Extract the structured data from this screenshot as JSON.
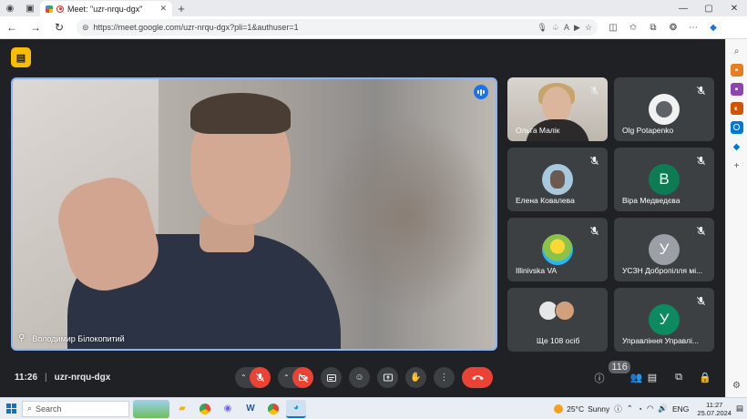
{
  "browser": {
    "tab_title": "Meet: \"uzr-nrqu-dgx\"",
    "url": "https://meet.google.com/uzr-nrqu-dgx?pli=1&authuser=1"
  },
  "meet": {
    "main_speaker": {
      "name": "Володимир Білокопитий"
    },
    "participants": [
      {
        "name": "Ольга Малік",
        "type": "photo"
      },
      {
        "name": "Olg Potapenko",
        "type": "image",
        "avatar_color": "#5f6368"
      },
      {
        "name": "Елена Ковалева",
        "type": "image",
        "avatar_color": "#7aa7c7"
      },
      {
        "name": "Віра Медведєва",
        "type": "initial",
        "initial": "В",
        "avatar_color": "#0d7c54"
      },
      {
        "name": "Illinivska VA",
        "type": "image",
        "avatar_color": "#8bc34a"
      },
      {
        "name": "УСЗН Добропілля мі...",
        "type": "initial",
        "initial": "У",
        "avatar_color": "#9aa0a6"
      },
      {
        "name": "Ще 108 осіб",
        "type": "group"
      },
      {
        "name": "Управління Управлі...",
        "type": "initial",
        "initial": "У",
        "avatar_color": "#0d8a5f"
      }
    ],
    "time": "11:26",
    "meeting_code": "uzr-nrqu-dgx",
    "people_count": "116"
  },
  "taskbar": {
    "search_placeholder": "Search",
    "temperature": "25°C",
    "weather": "Sunny",
    "language": "ENG",
    "clock_time": "11:27",
    "clock_date": "25.07.2024"
  },
  "colors": {
    "meet_bg": "#202124",
    "tile_bg": "#3c4043",
    "active_border": "#8ab4f8",
    "danger": "#ea4335"
  }
}
